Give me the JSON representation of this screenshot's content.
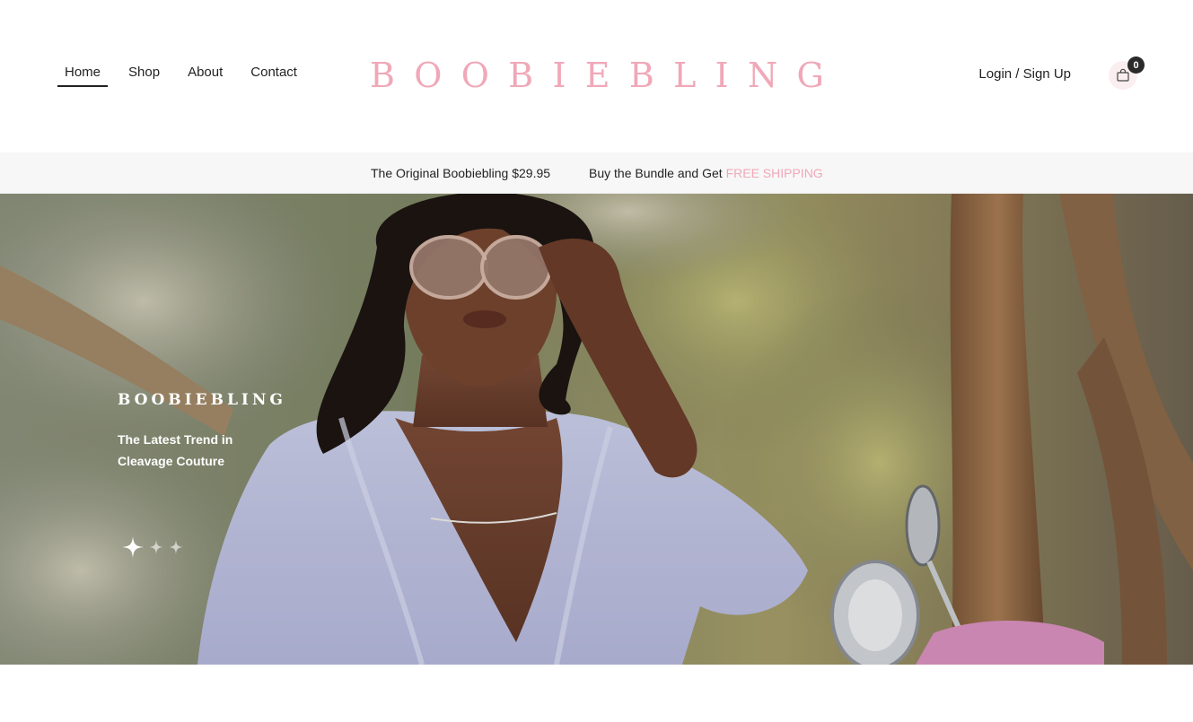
{
  "nav": {
    "items": [
      {
        "label": "Home"
      },
      {
        "label": "Shop"
      },
      {
        "label": "About"
      },
      {
        "label": "Contact"
      }
    ]
  },
  "logo": {
    "text": "BOOBIEBLING",
    "color": "#f0a8b8"
  },
  "account": {
    "login_label": "Login / Sign Up",
    "cart_count": "0",
    "cart_icon": "shopping-bag-icon"
  },
  "announcement": {
    "message_1": "The Original Boobiebling $29.95",
    "message_2_prefix": "Buy the Bundle and Get ",
    "message_2_highlight": "FREE SHIPPING",
    "highlight_color": "#f0a8b8"
  },
  "hero": {
    "brand": "BOOBIEBLING",
    "tagline": "The Latest Trend in Cleavage Couture",
    "slide_count": 3,
    "active_slide": 1,
    "indicator_icon": "sparkle-icon"
  }
}
